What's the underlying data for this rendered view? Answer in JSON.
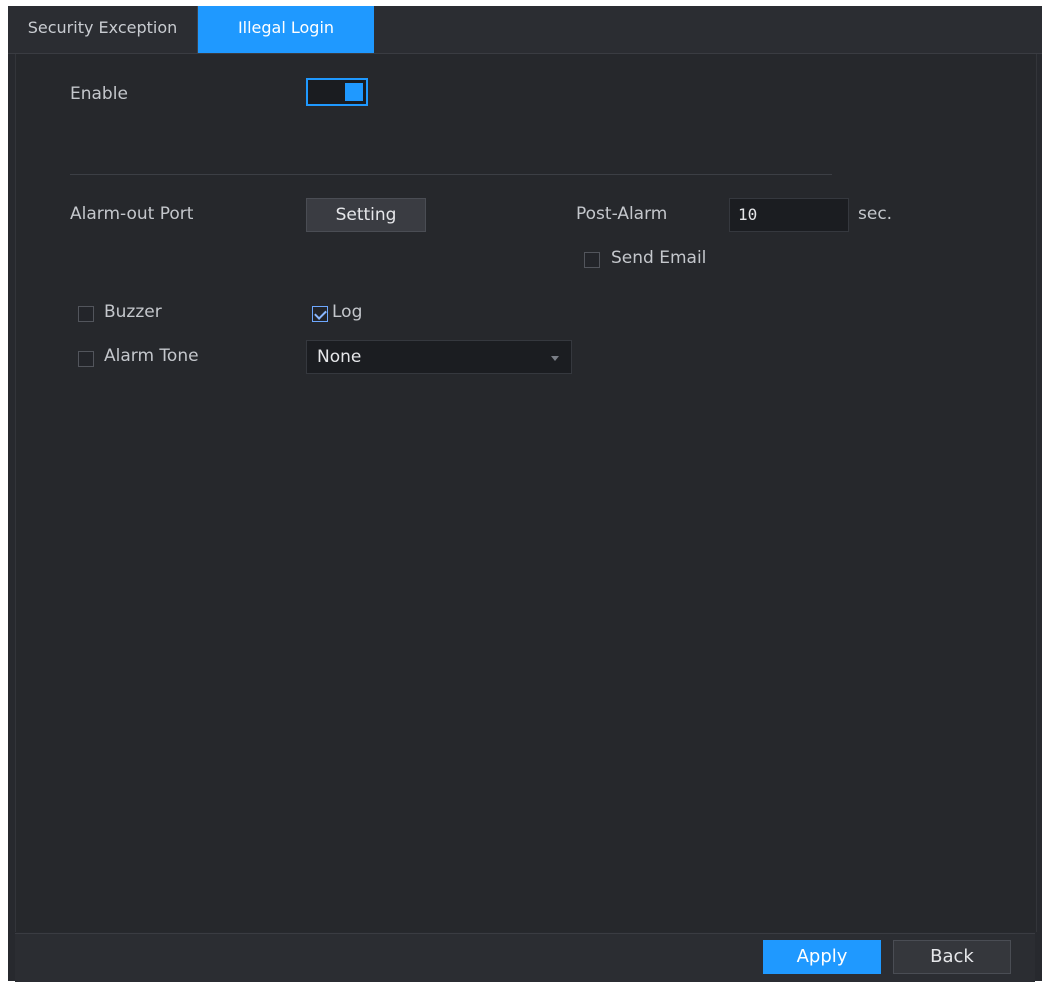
{
  "tabs": [
    {
      "label": "Security Exception",
      "active": false
    },
    {
      "label": "Illegal Login",
      "active": true
    }
  ],
  "form": {
    "enable_label": "Enable",
    "enable_on": true,
    "alarm_out_label": "Alarm-out Port",
    "setting_button": "Setting",
    "post_alarm_label": "Post-Alarm",
    "post_alarm_value": "10",
    "post_alarm_unit": "sec.",
    "send_email_label": "Send Email",
    "send_email_checked": false,
    "buzzer_label": "Buzzer",
    "buzzer_checked": false,
    "log_label": "Log",
    "log_checked": true,
    "alarm_tone_label": "Alarm Tone",
    "alarm_tone_checked": false,
    "alarm_tone_value": "None"
  },
  "footer": {
    "apply_label": "Apply",
    "back_label": "Back"
  },
  "colors": {
    "accent": "#1f99ff",
    "panel": "#26282c"
  }
}
